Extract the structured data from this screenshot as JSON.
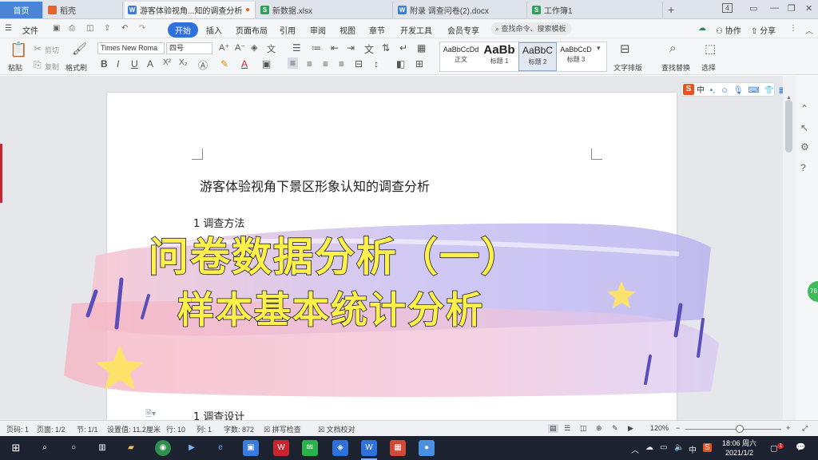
{
  "tabs": {
    "home": "首页",
    "items": [
      {
        "label": "稻壳",
        "icon": "docer-icon"
      },
      {
        "label": "游客体验视角...知的调查分析",
        "icon": "wps-writer-icon",
        "active": true
      },
      {
        "label": "新数据.xlsx",
        "icon": "spreadsheet-icon"
      },
      {
        "label": "附录 调查问卷(2).docx",
        "icon": "wps-writer-icon"
      },
      {
        "label": "工作簿1",
        "icon": "spreadsheet-icon"
      }
    ],
    "plus": "+",
    "badge": "4"
  },
  "menu": {
    "file": "文件",
    "start": "开始",
    "items": [
      "插入",
      "页面布局",
      "引用",
      "审阅",
      "视图",
      "章节",
      "开发工具",
      "会员专享"
    ],
    "search": "查找命令、搜索模板",
    "right": [
      "协作",
      "分享"
    ]
  },
  "ribbon": {
    "paste": "粘贴",
    "cut": "剪切",
    "copy": "复制",
    "format_painter": "格式刷",
    "font_name": "Times New Roma",
    "font_size": "四号",
    "styles": [
      {
        "preview": "AaBbCcDd",
        "name": "正文"
      },
      {
        "preview": "AaBb",
        "name": "标题 1"
      },
      {
        "preview": "AaBbC",
        "name": "标题 2"
      },
      {
        "preview": "AaBbCcD",
        "name": "标题 3"
      }
    ],
    "text_layout": "文字排版",
    "find_replace": "查找替换",
    "select": "选择"
  },
  "document": {
    "title": "游客体验视角下景区形象认知的调查分析",
    "heading1": "1 调查方法",
    "heading2": "1 调查设计",
    "heading2_number": "1"
  },
  "overlay": {
    "line1": "问卷数据分析（一）",
    "line2": "样本基本统计分析"
  },
  "ime": {
    "label": "中"
  },
  "side_badge": "76",
  "status": {
    "page": "页码: 1",
    "pages": "页面: 1/2",
    "section": "节: 1/1",
    "setting": "设置值: 11.2厘米",
    "row": "行: 10",
    "col": "列: 1",
    "words": "字数: 872",
    "spell": "拼写检查",
    "proof": "文档校对",
    "zoom": "120%"
  },
  "taskbar": {
    "ime": "中",
    "time": "18:06 周六",
    "date": "2021/1/2",
    "notification_count": "1"
  },
  "colors": {
    "accent": "#2e70dc",
    "overlay_text": "#fff04a",
    "overlay_stroke": "#1a1f2e",
    "wps_red": "#c8262f"
  }
}
